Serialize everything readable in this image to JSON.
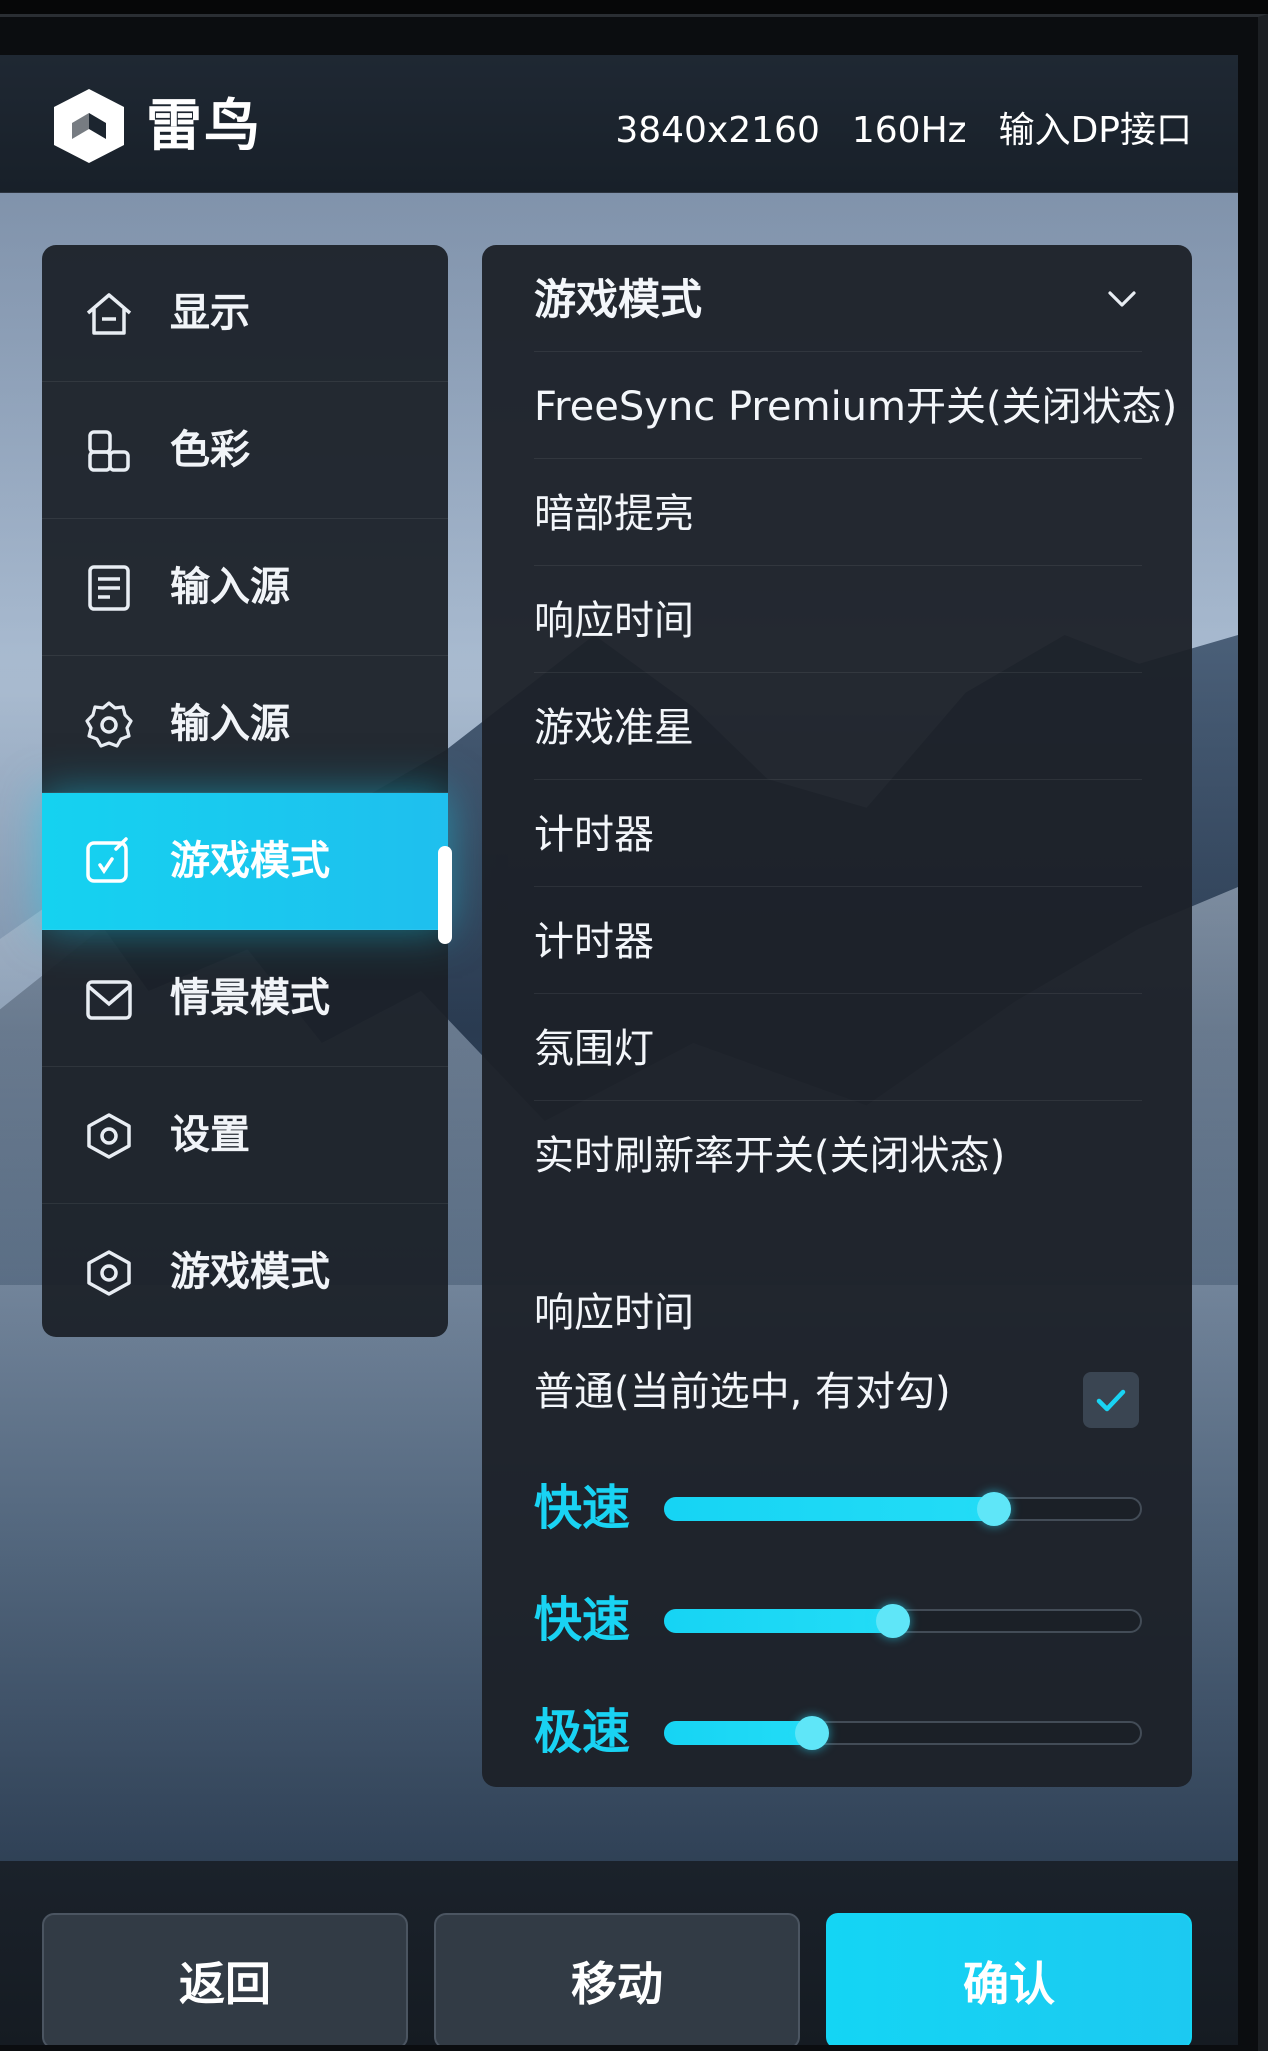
{
  "header": {
    "brand": "雷鸟",
    "resolution": "3840x2160",
    "refresh": "160Hz",
    "input": "输入DP接口"
  },
  "sidebar": {
    "items": [
      {
        "label": "显示",
        "icon": "home-icon"
      },
      {
        "label": "色彩",
        "icon": "color-blocks-icon"
      },
      {
        "label": "输入源",
        "icon": "document-icon"
      },
      {
        "label": "输入源",
        "icon": "gear-icon"
      },
      {
        "label": "游戏模式",
        "icon": "game-edit-icon",
        "active": true
      },
      {
        "label": "情景模式",
        "icon": "envelope-icon"
      },
      {
        "label": "设置",
        "icon": "settings-hexagon-icon"
      },
      {
        "label": "游戏模式",
        "icon": "settings-hexagon-icon"
      }
    ]
  },
  "panel": {
    "rows": [
      "游戏模式",
      "FreeSync Premium开关(关闭状态)",
      "暗部提亮",
      "响应时间",
      "游戏准星",
      "计时器",
      "计时器",
      "氛围灯",
      "实时刷新率开关(关闭状态)"
    ],
    "response_title": "响应时间",
    "option_normal": "普通(当前选中, 有对勾)",
    "speeds": [
      {
        "label": "快速",
        "level": 0.69
      },
      {
        "label": "快速",
        "level": 0.48
      },
      {
        "label": "极速",
        "level": 0.31
      }
    ]
  },
  "buttons": {
    "back": "返回",
    "move": "移动",
    "confirm": "确认"
  },
  "colors": {
    "accent": "#16d4f4",
    "panel": "#1c2128",
    "button": "#323b45"
  }
}
